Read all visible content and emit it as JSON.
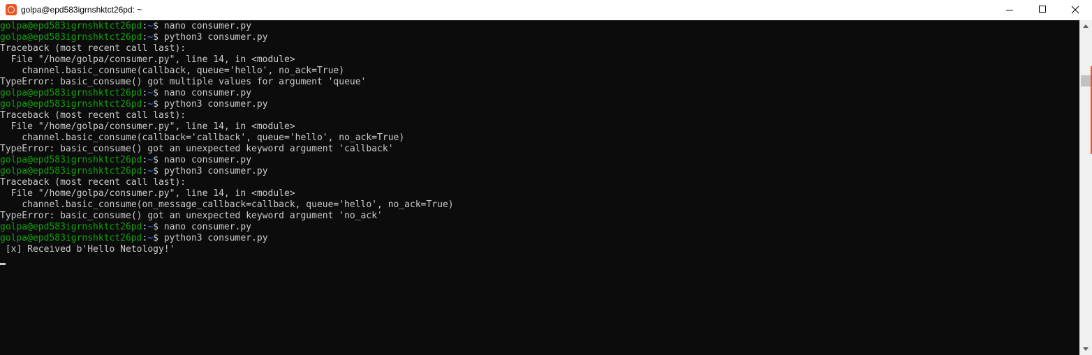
{
  "window": {
    "title": "golpa@epd583igrnshktct26pd: ~",
    "accent": "#e95420",
    "icon": "ubuntu-logo-icon"
  },
  "controls": {
    "minimize_icon": "minimize-icon",
    "maximize_icon": "maximize-icon",
    "close_icon": "close-icon"
  },
  "terminal": {
    "colors": {
      "background": "#0c0c0c",
      "text": "#cccccc",
      "prompt_user": "#13a10e",
      "prompt_path": "#3b78ff"
    },
    "lines": [
      {
        "type": "prompt",
        "user": "golpa@epd583igrnshktct26pd",
        "path": "~",
        "command": "nano consumer.py"
      },
      {
        "type": "prompt",
        "user": "golpa@epd583igrnshktct26pd",
        "path": "~",
        "command": "python3 consumer.py"
      },
      {
        "type": "output",
        "text": "Traceback (most recent call last):"
      },
      {
        "type": "output",
        "text": "  File \"/home/golpa/consumer.py\", line 14, in <module>"
      },
      {
        "type": "output",
        "text": "    channel.basic_consume(callback, queue='hello', no_ack=True)"
      },
      {
        "type": "output",
        "text": "TypeError: basic_consume() got multiple values for argument 'queue'"
      },
      {
        "type": "prompt",
        "user": "golpa@epd583igrnshktct26pd",
        "path": "~",
        "command": "nano consumer.py"
      },
      {
        "type": "prompt",
        "user": "golpa@epd583igrnshktct26pd",
        "path": "~",
        "command": "python3 consumer.py"
      },
      {
        "type": "output",
        "text": "Traceback (most recent call last):"
      },
      {
        "type": "output",
        "text": "  File \"/home/golpa/consumer.py\", line 14, in <module>"
      },
      {
        "type": "output",
        "text": "    channel.basic_consume(callback='callback', queue='hello', no_ack=True)"
      },
      {
        "type": "output",
        "text": "TypeError: basic_consume() got an unexpected keyword argument 'callback'"
      },
      {
        "type": "prompt",
        "user": "golpa@epd583igrnshktct26pd",
        "path": "~",
        "command": "nano consumer.py"
      },
      {
        "type": "prompt",
        "user": "golpa@epd583igrnshktct26pd",
        "path": "~",
        "command": "python3 consumer.py"
      },
      {
        "type": "output",
        "text": "Traceback (most recent call last):"
      },
      {
        "type": "output",
        "text": "  File \"/home/golpa/consumer.py\", line 14, in <module>"
      },
      {
        "type": "output",
        "text": "    channel.basic_consume(on_message_callback=callback, queue='hello', no_ack=True)"
      },
      {
        "type": "output",
        "text": "TypeError: basic_consume() got an unexpected keyword argument 'no_ack'"
      },
      {
        "type": "prompt",
        "user": "golpa@epd583igrnshktct26pd",
        "path": "~",
        "command": "nano consumer.py"
      },
      {
        "type": "prompt",
        "user": "golpa@epd583igrnshktct26pd",
        "path": "~",
        "command": "python3 consumer.py"
      },
      {
        "type": "output",
        "text": " [x] Received b'Hello Netology!'"
      }
    ]
  },
  "scrollbar": {
    "up_icon": "scroll-up-arrow-icon",
    "down_icon": "scroll-down-arrow-icon"
  }
}
